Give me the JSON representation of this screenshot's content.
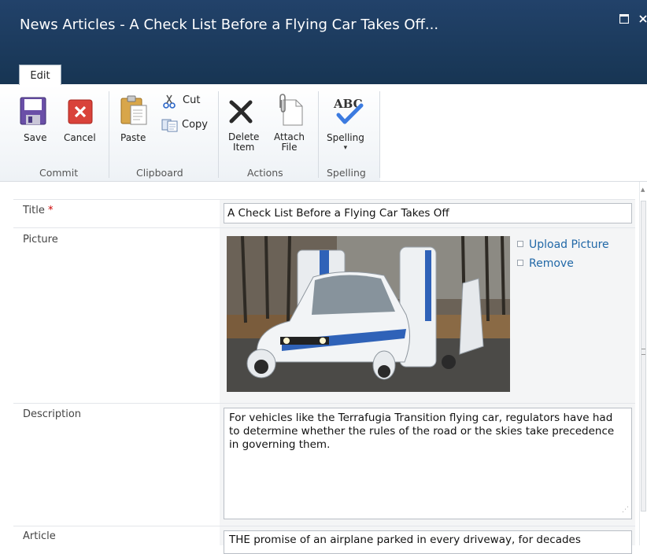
{
  "window": {
    "title": "News Articles - A Check List Before a Flying Car Takes Off...",
    "maximize_icon": "maximize-icon",
    "close_icon": "close-icon"
  },
  "tabs": [
    {
      "label": "Edit",
      "active": true
    }
  ],
  "ribbon": {
    "groups": [
      {
        "label": "Commit",
        "buttons": [
          {
            "label": "Save",
            "icon": "floppy-disk-icon"
          },
          {
            "label": "Cancel",
            "icon": "cancel-x-icon"
          }
        ]
      },
      {
        "label": "Clipboard",
        "buttons": [
          {
            "label": "Paste",
            "icon": "paste-icon"
          },
          {
            "label": "Cut",
            "icon": "scissors-icon"
          },
          {
            "label": "Copy",
            "icon": "copy-icon"
          }
        ]
      },
      {
        "label": "Actions",
        "buttons": [
          {
            "label_line1": "Delete",
            "label_line2": "Item",
            "icon": "delete-x-icon"
          },
          {
            "label_line1": "Attach",
            "label_line2": "File",
            "icon": "paperclip-icon"
          }
        ]
      },
      {
        "label": "Spelling",
        "buttons": [
          {
            "label": "Spelling",
            "icon": "spelling-check-icon",
            "dropdown_glyph": "▾"
          }
        ]
      }
    ]
  },
  "form": {
    "title": {
      "label": "Title",
      "required_mark": "*",
      "value": "A Check List Before a Flying Car Takes Off"
    },
    "picture": {
      "label": "Picture",
      "upload_link": "Upload Picture",
      "remove_link": "Remove"
    },
    "description": {
      "label": "Description",
      "value": "For vehicles like the Terrafugia Transition flying car, regulators have had to determine whether the rules of the road or the skies take precedence in governing them."
    },
    "article": {
      "label": "Article",
      "value": "THE promise of an airplane parked in every driveway, for decades"
    }
  },
  "colors": {
    "titlebar": "#1c3a5c",
    "link": "#2168a7",
    "required": "#cc0000"
  }
}
